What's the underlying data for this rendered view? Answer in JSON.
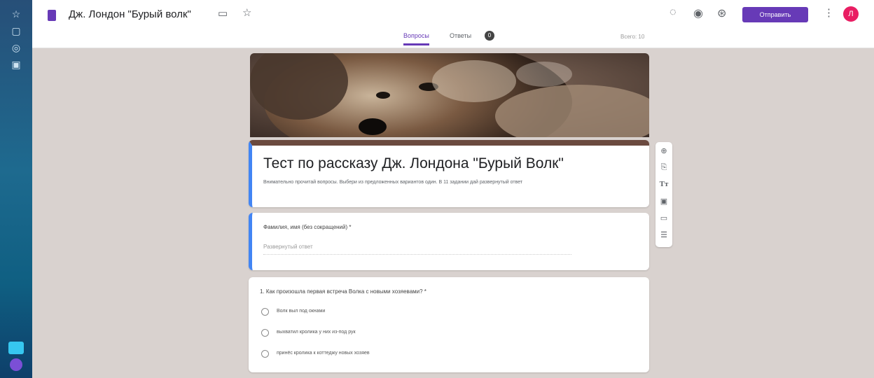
{
  "os_strip": {
    "icons": [
      "star-icon",
      "tablet-icon",
      "target-icon",
      "box-icon"
    ]
  },
  "topbar": {
    "doc_title": "Дж. Лондон \"Бурый волк\"",
    "send_label": "Отправить",
    "avatar_letter": "Л",
    "icons": [
      "palette-icon",
      "eye-icon",
      "settings-icon"
    ]
  },
  "tabs": {
    "questions": "Вопросы",
    "answers": "Ответы",
    "answers_count": "0",
    "score": "Всего: 10"
  },
  "form": {
    "title": "Тест по рассказу Дж. Лондона \"Бурый Волк\"",
    "description": "Внимательно прочитай вопросы. Выбери из предложенных вариантов один. В 11 задании дай развернутый ответ",
    "q1": {
      "label": "Фамилия, имя (без сокращений) *",
      "placeholder": "Развернутый ответ"
    },
    "q2": {
      "label": "1. Как произошла первая встреча Волка с новыми хозяевами? *",
      "options": [
        "Волк выл под окнами",
        "выхватил кролика у них из-под рук",
        "принёс кролика к коттеджу новых хозяев"
      ]
    }
  },
  "side_tools": {
    "icons": [
      "add-question-icon",
      "import-icon",
      "title-icon",
      "image-icon",
      "video-icon",
      "section-icon"
    ]
  },
  "colors": {
    "accent": "#673ab7",
    "focus": "#4285f4",
    "header_border": "#6b4a3f",
    "background": "#d9d2cf"
  }
}
